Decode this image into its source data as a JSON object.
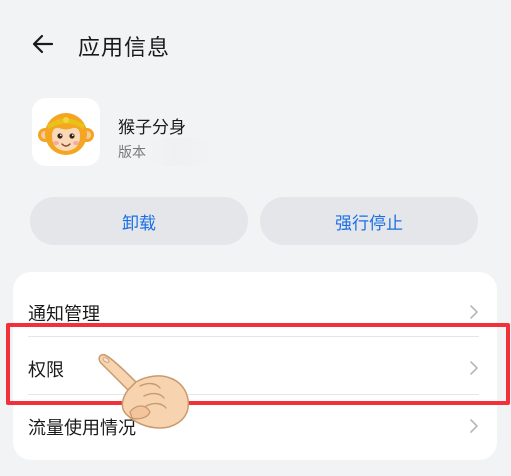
{
  "header": {
    "title": "应用信息",
    "back_icon": "arrow-left-icon"
  },
  "app": {
    "name": "猴子分身",
    "version_label": "版本",
    "icon": "monkey-king-icon"
  },
  "actions": {
    "uninstall_label": "卸载",
    "force_stop_label": "强行停止"
  },
  "settings": {
    "items": [
      {
        "label": "通知管理"
      },
      {
        "label": "权限"
      },
      {
        "label": "流量使用情况"
      }
    ]
  },
  "colors": {
    "accent": "#1a6fe8",
    "highlight": "#f2303a",
    "background": "#f1f3f5"
  }
}
